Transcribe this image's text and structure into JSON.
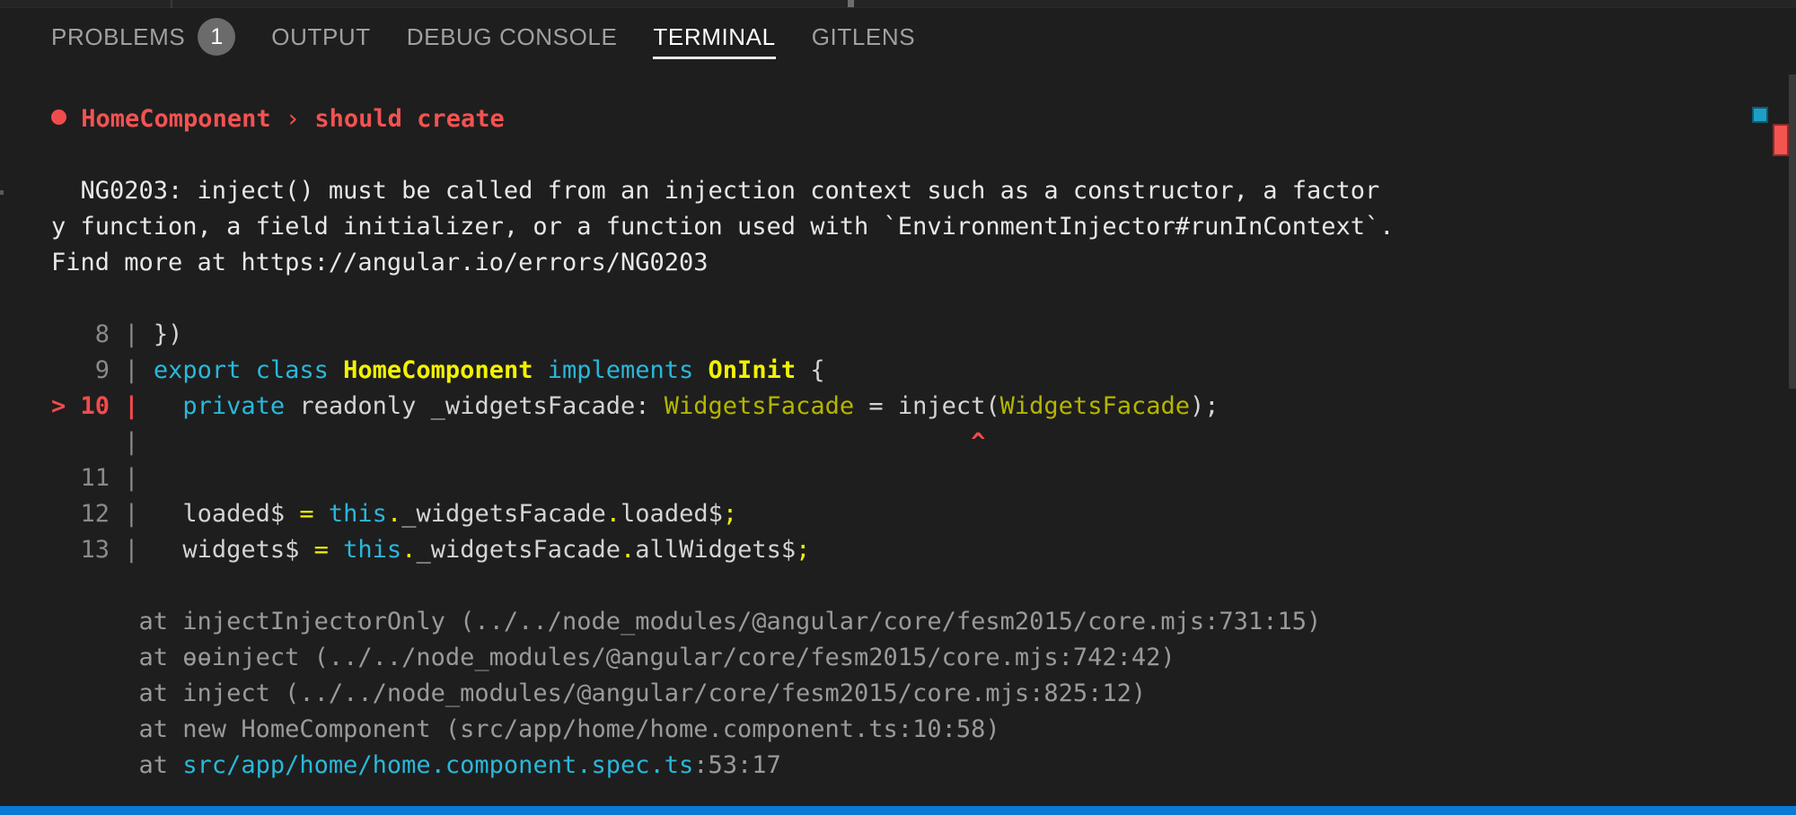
{
  "panel": {
    "tabs": [
      {
        "label": "PROBLEMS",
        "badge": "1",
        "active": false
      },
      {
        "label": "OUTPUT",
        "badge": null,
        "active": false
      },
      {
        "label": "DEBUG CONSOLE",
        "badge": null,
        "active": false
      },
      {
        "label": "TERMINAL",
        "badge": null,
        "active": true
      },
      {
        "label": "GITLENS",
        "badge": null,
        "active": false
      }
    ]
  },
  "terminal": {
    "test_header": {
      "status_icon": "fail-dot-icon",
      "suite": "HomeComponent",
      "separator": "›",
      "test": "should create"
    },
    "error": {
      "line1": "  NG0203: inject() must be called from an injection context such as a constructor, a factor",
      "line2": "y function, a field initializer, or a function used with `EnvironmentInjector#runInContext`.",
      "line3": "Find more at https://angular.io/errors/NG0203"
    },
    "code_frame": {
      "gutter_8": "   8 |",
      "gutter_9": "   9 |",
      "gutter_10": "> 10 |",
      "gutter_cont": "     |",
      "gutter_11": "  11 |",
      "gutter_12": "  12 |",
      "gutter_13": "  13 |",
      "line8": "})",
      "line9": {
        "kw_export_class": "export class ",
        "type_home": "HomeComponent",
        "kw_implements": " implements ",
        "type_oninit": "OnInit",
        "brace": " {"
      },
      "line10": {
        "kw_private": "private",
        "plain_readonly": " readonly _widgetsFacade: ",
        "type_widgets": "WidgetsFacade",
        "plain_eq": " = inject(",
        "type_widgets2": "WidgetsFacade",
        "plain_end": ");"
      },
      "caret": "^",
      "line12": {
        "name": "loaded$",
        "eq": " = ",
        "this": "this",
        "dot1": ".",
        "prop": "_widgetsFacade",
        "dot2": ".",
        "member": "loaded$",
        "semi": ";"
      },
      "line13": {
        "name": "widgets$",
        "eq": " = ",
        "this": "this",
        "dot1": ".",
        "prop": "_widgetsFacade",
        "dot2": ".",
        "member": "allWidgets$",
        "semi": ";"
      }
    },
    "stack": [
      "      at injectInjectorOnly (../../node_modules/@angular/core/fesm2015/core.mjs:731:15)",
      "      at ɵɵinject (../../node_modules/@angular/core/fesm2015/core.mjs:742:42)",
      "      at inject (../../node_modules/@angular/core/fesm2015/core.mjs:825:12)",
      "      at new HomeComponent (src/app/home/home.component.ts:10:58)"
    ],
    "stack_last": {
      "prefix": "      at ",
      "link": "src/app/home/home.component.spec.ts",
      "suffix": ":53:17"
    }
  },
  "decorations": {
    "overview_marker_cyan": "info-marker",
    "overview_marker_red": "error-marker",
    "accent_blue": "#0a7ad6",
    "error_red": "#f14c4c",
    "keyword_cyan": "#29b8db",
    "type_yellow": "#f2f200"
  }
}
